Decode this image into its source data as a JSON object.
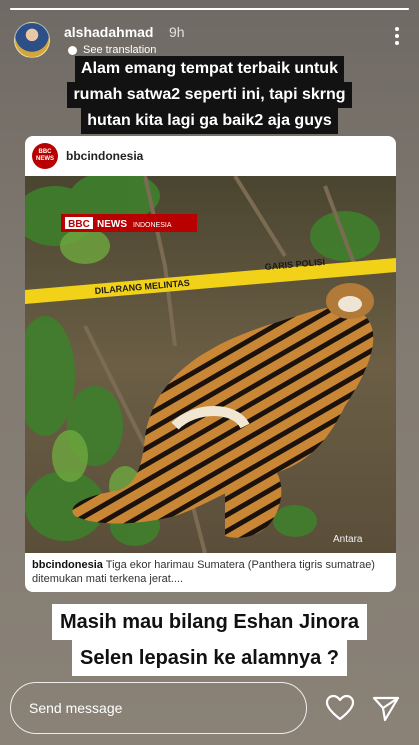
{
  "story": {
    "progress_fraction": 1.0,
    "username": "alshadahmad",
    "time": "9h",
    "translation_link": "See translation"
  },
  "caption_top": [
    "Alam emang tempat terbaik untuk",
    "rumah satwa2 seperti ini, tapi skrng",
    "hutan kita lagi ga baik2 aja guys"
  ],
  "post": {
    "username": "bbcindonesia",
    "logo_text": [
      "BBC",
      "NEWS"
    ],
    "banner_brand": "BBC",
    "banner_news": "NEWS",
    "banner_region": "INDONESIA",
    "tape_text_1": "GARIS POLISI",
    "tape_text_2": "DILARANG MELINTAS",
    "watermark": "Antara",
    "caption_user": "bbcindonesia",
    "caption_text": "Tiga ekor harimau Sumatera (Panthera tigris sumatrae) ditemukan mati terkena jerat...."
  },
  "caption_bottom": [
    "Masih mau bilang Eshan Jinora",
    "Selen lepasin ke alamnya ?"
  ],
  "reply": {
    "placeholder": "Send message"
  },
  "icons": {
    "like": "heart-icon",
    "send": "send-icon",
    "more": "more-options-icon"
  }
}
